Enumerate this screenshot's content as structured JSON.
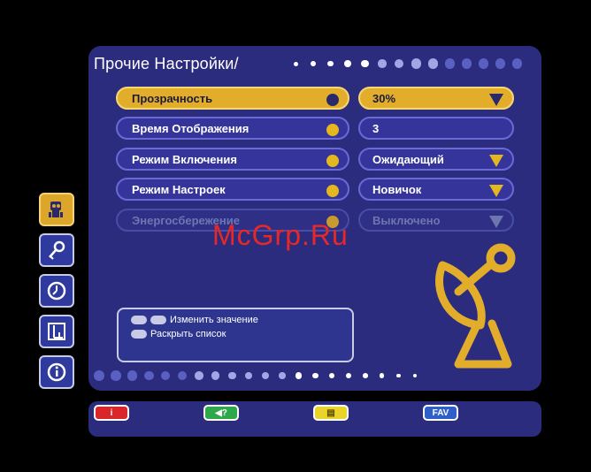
{
  "menu": {
    "title": "Прочие Настройки/"
  },
  "rows": [
    {
      "label": "Прозрачность",
      "value": "30%",
      "state": "selected",
      "has_dropdown": true
    },
    {
      "label": "Время Отображения",
      "value": "3",
      "state": "normal",
      "has_dropdown": false
    },
    {
      "label": "Режим Включения",
      "value": "Ожидающий",
      "state": "normal",
      "has_dropdown": true
    },
    {
      "label": "Режим Настроек",
      "value": "Новичок",
      "state": "normal",
      "has_dropdown": true
    },
    {
      "label": "Энергосбережение",
      "value": "Выключено",
      "state": "disabled",
      "has_dropdown": true
    }
  ],
  "sidebar": {
    "items": [
      {
        "icon": "settings-robot-icon",
        "active": true
      },
      {
        "icon": "key-icon",
        "active": false
      },
      {
        "icon": "clock-icon",
        "active": false
      },
      {
        "icon": "chart-icon",
        "active": false
      },
      {
        "icon": "info-icon",
        "active": false
      }
    ]
  },
  "help": {
    "line1": "Изменить значение",
    "line2": "Раскрыть список"
  },
  "function_keys": [
    {
      "label": "i",
      "color": "#d8262a"
    },
    {
      "label": "◀?",
      "color": "#2ea84a"
    },
    {
      "label": "▤",
      "color": "#e8d42a"
    },
    {
      "label": "FAV",
      "color": "#2f5fc8"
    }
  ],
  "watermark": "McGrp.Ru",
  "colors": {
    "panel": "#2c2c7e",
    "accent": "#e2ad2a",
    "selected_text": "#1a1a3a"
  }
}
